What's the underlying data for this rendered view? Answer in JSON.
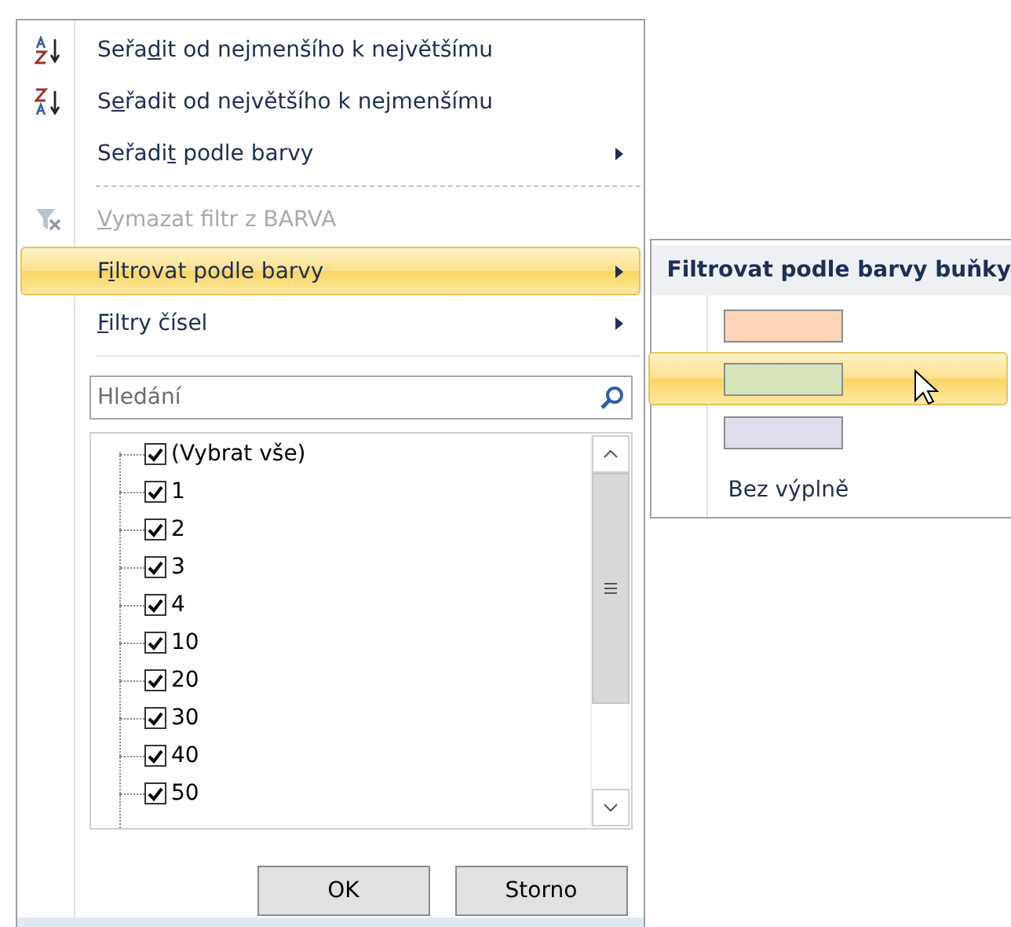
{
  "menu": {
    "items": [
      {
        "kind": "sort-asc",
        "label": [
          {
            "text": "Seřa",
            "underline": false
          },
          {
            "text": "d",
            "underline": true
          },
          {
            "text": "it od nejmenšího k největšímu",
            "underline": false
          }
        ],
        "disabled": false,
        "selected": false,
        "submenu": false
      },
      {
        "kind": "sort-desc",
        "label": [
          {
            "text": "S",
            "underline": false
          },
          {
            "text": "e",
            "underline": true
          },
          {
            "text": "řadit od největšího k nejmenšímu",
            "underline": false
          }
        ],
        "disabled": false,
        "selected": false,
        "submenu": false
      },
      {
        "kind": "plain",
        "label": [
          {
            "text": "Seřadi",
            "underline": false
          },
          {
            "text": "t",
            "underline": true
          },
          {
            "text": " podle barvy",
            "underline": false
          }
        ],
        "disabled": false,
        "selected": false,
        "submenu": true
      },
      {
        "kind": "separator"
      },
      {
        "kind": "clear-filter",
        "label": [
          {
            "text": "V",
            "underline": true
          },
          {
            "text": "ymazat filtr z BARVA",
            "underline": false
          }
        ],
        "disabled": true,
        "selected": false,
        "submenu": false
      },
      {
        "kind": "plain",
        "label": [
          {
            "text": "F",
            "underline": false
          },
          {
            "text": "i",
            "underline": true
          },
          {
            "text": "ltrovat podle barvy",
            "underline": false
          }
        ],
        "disabled": false,
        "selected": true,
        "submenu": true
      },
      {
        "kind": "plain",
        "label": [
          {
            "text": "F",
            "underline": true
          },
          {
            "text": "iltry čísel",
            "underline": false
          }
        ],
        "disabled": false,
        "selected": false,
        "submenu": true
      },
      {
        "kind": "separator"
      }
    ],
    "search": {
      "placeholder": "Hledání"
    },
    "values": [
      {
        "label": "(Vybrat vše)",
        "checked": true
      },
      {
        "label": "1",
        "checked": true
      },
      {
        "label": "2",
        "checked": true
      },
      {
        "label": "3",
        "checked": true
      },
      {
        "label": "4",
        "checked": true
      },
      {
        "label": "10",
        "checked": true
      },
      {
        "label": "20",
        "checked": true
      },
      {
        "label": "30",
        "checked": true
      },
      {
        "label": "40",
        "checked": true
      },
      {
        "label": "50",
        "checked": true
      }
    ],
    "buttons": [
      "OK",
      "Storno"
    ]
  },
  "submenu": {
    "title": "Filtrovat podle barvy buňky",
    "colors": [
      {
        "color": "#fcd5b5",
        "selected": false
      },
      {
        "color": "#d7e4bd",
        "selected": true
      },
      {
        "color": "#e1dcec",
        "selected": false
      }
    ],
    "no_fill": {
      "label": "Bez výplně"
    }
  }
}
